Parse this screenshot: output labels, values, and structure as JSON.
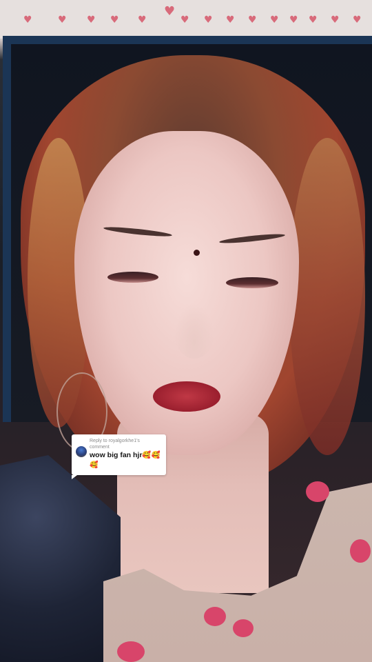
{
  "reply_sticker": {
    "reply_to_line": "Reply to royalgorkhe1's",
    "comment_word": "comment",
    "comment_text": "wow big fan hjr🥰🥰",
    "comment_text_overflow": "🥰",
    "avatar_icon": "avatar-icon"
  },
  "decor": {
    "heart_glyph": "♥",
    "heart_color": "#d86a7a"
  }
}
